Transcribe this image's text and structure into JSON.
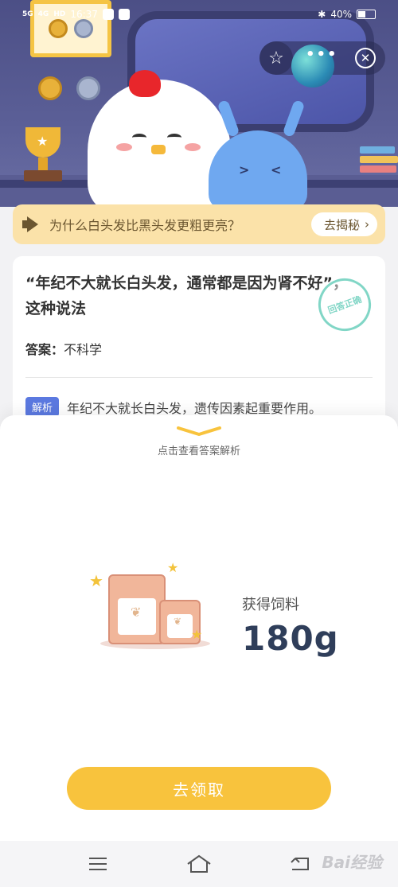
{
  "status_bar": {
    "signal_1": "5G",
    "signal_2": "4G",
    "hd_badge": "HD",
    "time": "16:37",
    "battery": "40%"
  },
  "banner": {
    "question": "为什么白头发比黑头发更粗更亮？",
    "button_label": "去揭秘"
  },
  "question_card": {
    "title": "“年纪不大就长白头发，通常都是因为肾不好”，这种说法",
    "answer_label": "答案：",
    "answer_value": "不科学",
    "explain_tag": "解析",
    "explain_text": "年纪不大就长白头发，遗传因素起重要作用。",
    "stamp_text": "回答正确"
  },
  "sheet": {
    "hint": "点击查看答案解析",
    "reward_label": "获得饲料",
    "reward_amount": "180g",
    "claim_button": "去领取"
  },
  "watermark": "Bai经验",
  "colors": {
    "hero_bg": "#4c4f86",
    "banner_bg": "#fbe2a9",
    "accent_yellow": "#f8c33d",
    "tag_blue": "#5b79e0",
    "stamp_green": "#58c9b4"
  },
  "icons": [
    "star-icon",
    "more-icon",
    "close-icon",
    "speaker-icon",
    "chevron-right-icon",
    "menu-icon",
    "home-icon",
    "back-icon",
    "bluetooth-icon",
    "battery-icon"
  ]
}
